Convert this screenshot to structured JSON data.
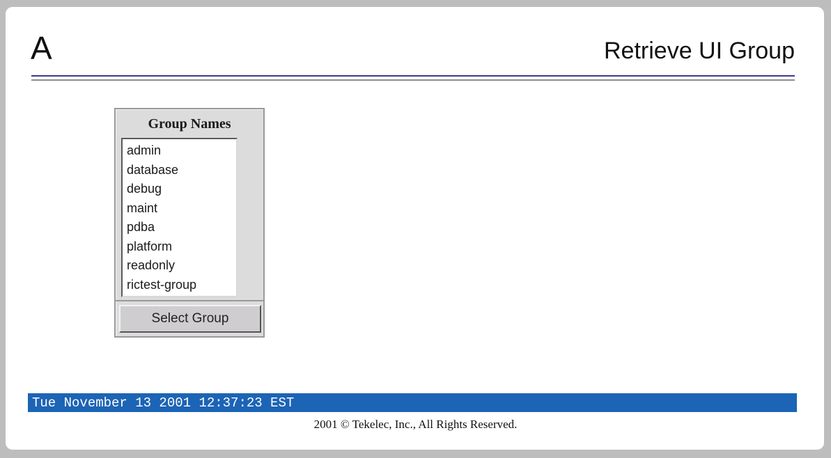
{
  "header": {
    "logo": "A",
    "title": "Retrieve UI Group"
  },
  "group_panel": {
    "heading": "Group Names",
    "options": [
      "admin",
      "database",
      "debug",
      "maint",
      "pdba",
      "platform",
      "readonly",
      "rictest-group"
    ],
    "button_label": "Select Group"
  },
  "status_bar": {
    "datetime": "Tue November 13 2001 12:37:23 EST",
    "color": "#1c64b5"
  },
  "footer": {
    "copyright": "2001 © Tekelec, Inc., All Rights Reserved."
  }
}
